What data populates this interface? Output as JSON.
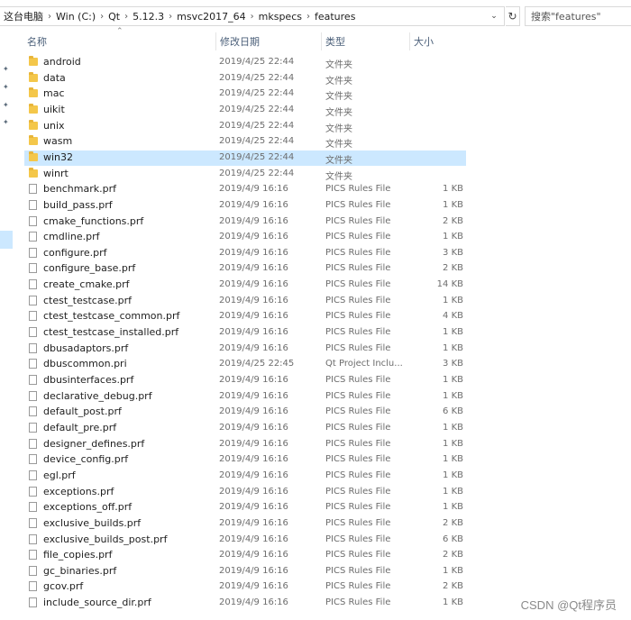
{
  "address": {
    "crumbs": [
      "这台电脑",
      "Win (C:)",
      "Qt",
      "5.12.3",
      "msvc2017_64",
      "mkspecs",
      "features"
    ],
    "search_placeholder": "搜索\"features\""
  },
  "columns": {
    "name": "名称",
    "date": "修改日期",
    "type": "类型",
    "size": "大小"
  },
  "selected_row": "win32",
  "rows": [
    {
      "name": "android",
      "date": "2019/4/25 22:44",
      "type": "文件夹",
      "size": "",
      "kind": "folder"
    },
    {
      "name": "data",
      "date": "2019/4/25 22:44",
      "type": "文件夹",
      "size": "",
      "kind": "folder"
    },
    {
      "name": "mac",
      "date": "2019/4/25 22:44",
      "type": "文件夹",
      "size": "",
      "kind": "folder"
    },
    {
      "name": "uikit",
      "date": "2019/4/25 22:44",
      "type": "文件夹",
      "size": "",
      "kind": "folder"
    },
    {
      "name": "unix",
      "date": "2019/4/25 22:44",
      "type": "文件夹",
      "size": "",
      "kind": "folder"
    },
    {
      "name": "wasm",
      "date": "2019/4/25 22:44",
      "type": "文件夹",
      "size": "",
      "kind": "folder"
    },
    {
      "name": "win32",
      "date": "2019/4/25 22:44",
      "type": "文件夹",
      "size": "",
      "kind": "folder"
    },
    {
      "name": "winrt",
      "date": "2019/4/25 22:44",
      "type": "文件夹",
      "size": "",
      "kind": "folder"
    },
    {
      "name": "benchmark.prf",
      "date": "2019/4/9 16:16",
      "type": "PICS Rules File",
      "size": "1 KB",
      "kind": "file"
    },
    {
      "name": "build_pass.prf",
      "date": "2019/4/9 16:16",
      "type": "PICS Rules File",
      "size": "1 KB",
      "kind": "file"
    },
    {
      "name": "cmake_functions.prf",
      "date": "2019/4/9 16:16",
      "type": "PICS Rules File",
      "size": "2 KB",
      "kind": "file"
    },
    {
      "name": "cmdline.prf",
      "date": "2019/4/9 16:16",
      "type": "PICS Rules File",
      "size": "1 KB",
      "kind": "file"
    },
    {
      "name": "configure.prf",
      "date": "2019/4/9 16:16",
      "type": "PICS Rules File",
      "size": "3 KB",
      "kind": "file"
    },
    {
      "name": "configure_base.prf",
      "date": "2019/4/9 16:16",
      "type": "PICS Rules File",
      "size": "2 KB",
      "kind": "file"
    },
    {
      "name": "create_cmake.prf",
      "date": "2019/4/9 16:16",
      "type": "PICS Rules File",
      "size": "14 KB",
      "kind": "file"
    },
    {
      "name": "ctest_testcase.prf",
      "date": "2019/4/9 16:16",
      "type": "PICS Rules File",
      "size": "1 KB",
      "kind": "file"
    },
    {
      "name": "ctest_testcase_common.prf",
      "date": "2019/4/9 16:16",
      "type": "PICS Rules File",
      "size": "4 KB",
      "kind": "file"
    },
    {
      "name": "ctest_testcase_installed.prf",
      "date": "2019/4/9 16:16",
      "type": "PICS Rules File",
      "size": "1 KB",
      "kind": "file"
    },
    {
      "name": "dbusadaptors.prf",
      "date": "2019/4/9 16:16",
      "type": "PICS Rules File",
      "size": "1 KB",
      "kind": "file"
    },
    {
      "name": "dbuscommon.pri",
      "date": "2019/4/25 22:45",
      "type": "Qt Project Inclu...",
      "size": "3 KB",
      "kind": "file"
    },
    {
      "name": "dbusinterfaces.prf",
      "date": "2019/4/9 16:16",
      "type": "PICS Rules File",
      "size": "1 KB",
      "kind": "file"
    },
    {
      "name": "declarative_debug.prf",
      "date": "2019/4/9 16:16",
      "type": "PICS Rules File",
      "size": "1 KB",
      "kind": "file"
    },
    {
      "name": "default_post.prf",
      "date": "2019/4/9 16:16",
      "type": "PICS Rules File",
      "size": "6 KB",
      "kind": "file"
    },
    {
      "name": "default_pre.prf",
      "date": "2019/4/9 16:16",
      "type": "PICS Rules File",
      "size": "1 KB",
      "kind": "file"
    },
    {
      "name": "designer_defines.prf",
      "date": "2019/4/9 16:16",
      "type": "PICS Rules File",
      "size": "1 KB",
      "kind": "file"
    },
    {
      "name": "device_config.prf",
      "date": "2019/4/9 16:16",
      "type": "PICS Rules File",
      "size": "1 KB",
      "kind": "file"
    },
    {
      "name": "egl.prf",
      "date": "2019/4/9 16:16",
      "type": "PICS Rules File",
      "size": "1 KB",
      "kind": "file"
    },
    {
      "name": "exceptions.prf",
      "date": "2019/4/9 16:16",
      "type": "PICS Rules File",
      "size": "1 KB",
      "kind": "file"
    },
    {
      "name": "exceptions_off.prf",
      "date": "2019/4/9 16:16",
      "type": "PICS Rules File",
      "size": "1 KB",
      "kind": "file"
    },
    {
      "name": "exclusive_builds.prf",
      "date": "2019/4/9 16:16",
      "type": "PICS Rules File",
      "size": "2 KB",
      "kind": "file"
    },
    {
      "name": "exclusive_builds_post.prf",
      "date": "2019/4/9 16:16",
      "type": "PICS Rules File",
      "size": "6 KB",
      "kind": "file"
    },
    {
      "name": "file_copies.prf",
      "date": "2019/4/9 16:16",
      "type": "PICS Rules File",
      "size": "2 KB",
      "kind": "file"
    },
    {
      "name": "gc_binaries.prf",
      "date": "2019/4/9 16:16",
      "type": "PICS Rules File",
      "size": "1 KB",
      "kind": "file"
    },
    {
      "name": "gcov.prf",
      "date": "2019/4/9 16:16",
      "type": "PICS Rules File",
      "size": "2 KB",
      "kind": "file"
    },
    {
      "name": "include_source_dir.prf",
      "date": "2019/4/9 16:16",
      "type": "PICS Rules File",
      "size": "1 KB",
      "kind": "file"
    }
  ],
  "watermark": "CSDN @Qt程序员",
  "colors": {
    "selection": "#cce8ff",
    "folder": "#f4c74a",
    "header_text": "#4c607a"
  }
}
